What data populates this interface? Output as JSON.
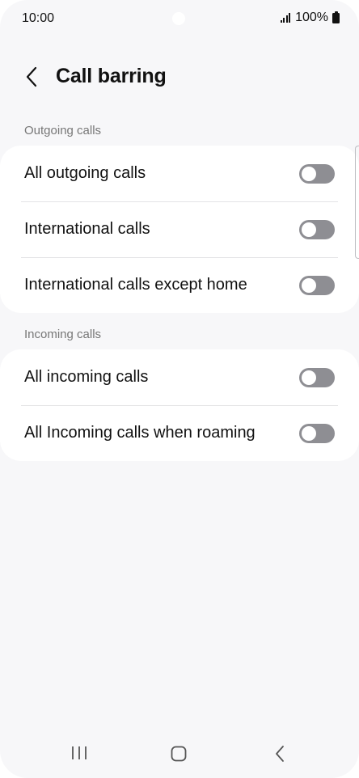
{
  "status_bar": {
    "time": "10:00",
    "battery": "100%"
  },
  "header": {
    "title": "Call barring"
  },
  "sections": [
    {
      "label": "Outgoing calls",
      "items": [
        {
          "label": "All outgoing calls",
          "enabled": false
        },
        {
          "label": "International calls",
          "enabled": false
        },
        {
          "label": "International calls except home",
          "enabled": false
        }
      ]
    },
    {
      "label": "Incoming calls",
      "items": [
        {
          "label": "All incoming calls",
          "enabled": false
        },
        {
          "label": "All Incoming calls when roaming",
          "enabled": false
        }
      ]
    }
  ],
  "colors": {
    "background": "#f7f7f9",
    "card": "#ffffff",
    "toggle_off": "#8e8e93",
    "section_label": "#777777"
  },
  "icons": {
    "back": "chevron-left-icon",
    "nav_recents": "recents-icon",
    "nav_home": "home-icon",
    "nav_back": "back-icon"
  }
}
